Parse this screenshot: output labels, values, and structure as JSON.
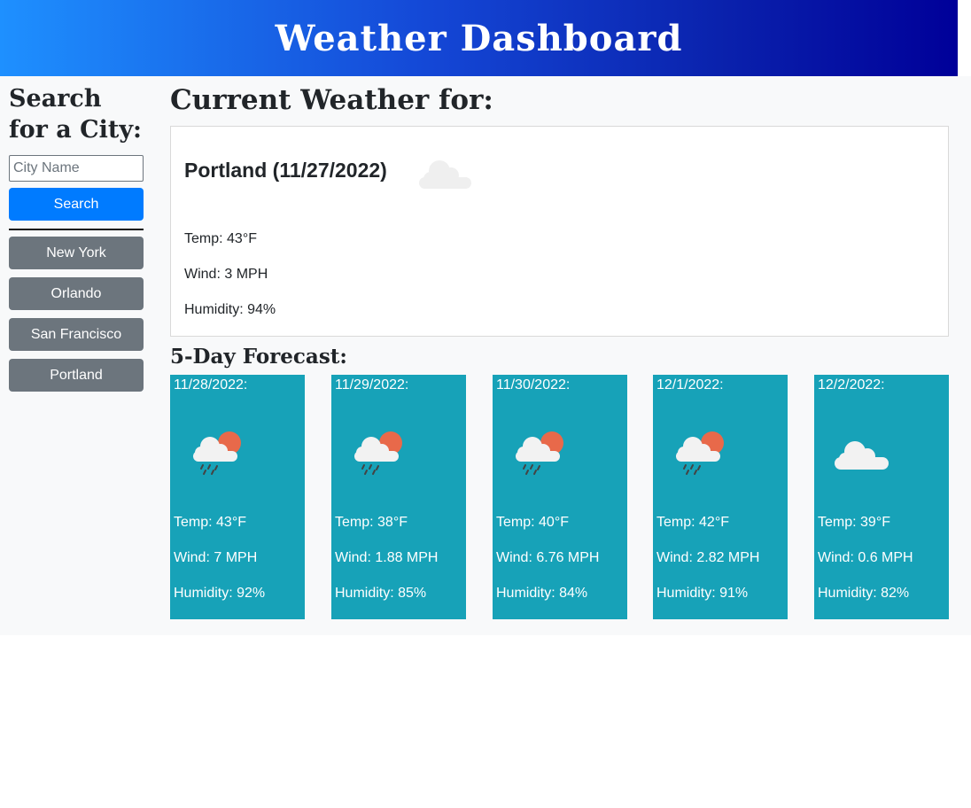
{
  "header": {
    "title": "Weather Dashboard"
  },
  "sidebar": {
    "heading": "Search for a City:",
    "search_placeholder": "City Name",
    "search_value": "",
    "search_label": "Search",
    "history": [
      {
        "label": "New York"
      },
      {
        "label": "Orlando"
      },
      {
        "label": "San Francisco"
      },
      {
        "label": "Portland"
      }
    ]
  },
  "current": {
    "heading": "Current Weather for:",
    "title": "Portland (11/27/2022)",
    "icon": "cloud-icon",
    "temp": "Temp: 43°F",
    "wind": "Wind: 3 MPH",
    "humidity": "Humidity: 94%"
  },
  "forecast": {
    "heading": "5-Day Forecast:",
    "days": [
      {
        "date": "11/28/2022:",
        "icon": "rain-sun-icon",
        "temp": "Temp: 43°F",
        "wind": "Wind: 7 MPH",
        "humidity": "Humidity: 92%"
      },
      {
        "date": "11/29/2022:",
        "icon": "rain-sun-icon",
        "temp": "Temp: 38°F",
        "wind": "Wind: 1.88 MPH",
        "humidity": "Humidity: 85%"
      },
      {
        "date": "11/30/2022:",
        "icon": "rain-sun-icon",
        "temp": "Temp: 40°F",
        "wind": "Wind: 6.76 MPH",
        "humidity": "Humidity: 84%"
      },
      {
        "date": "12/1/2022:",
        "icon": "rain-sun-icon",
        "temp": "Temp: 42°F",
        "wind": "Wind: 2.82 MPH",
        "humidity": "Humidity: 91%"
      },
      {
        "date": "12/2/2022:",
        "icon": "cloud-icon",
        "temp": "Temp: 39°F",
        "wind": "Wind: 0.6 MPH",
        "humidity": "Humidity: 82%"
      }
    ]
  },
  "colors": {
    "header_gradient_start": "#1e90ff",
    "header_gradient_end": "#000099",
    "primary": "#007bff",
    "secondary": "#6c757d",
    "forecast_card": "#17a2b8"
  }
}
